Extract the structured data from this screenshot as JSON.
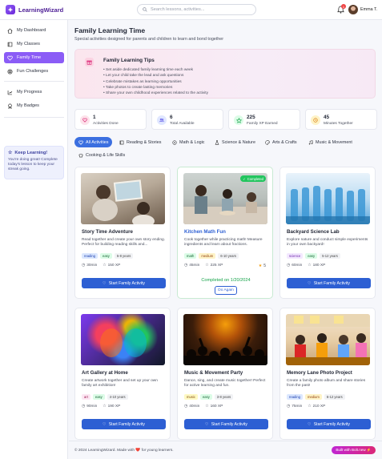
{
  "app": {
    "name": "LearningWizard"
  },
  "search": {
    "placeholder": "Search lessons, activities..."
  },
  "header": {
    "notification_count": "1",
    "user_name": "Emma T."
  },
  "sidebar": {
    "items": [
      {
        "label": "My Dashboard",
        "icon": "home-icon"
      },
      {
        "label": "My Classes",
        "icon": "book-icon"
      },
      {
        "label": "Family Time",
        "icon": "heart-icon",
        "active": true
      },
      {
        "label": "Fun Challenges",
        "icon": "target-icon"
      },
      {
        "label": "My Progress",
        "icon": "chart-icon"
      },
      {
        "label": "My Badges",
        "icon": "award-icon"
      }
    ],
    "motivation": {
      "title": "Keep Learning!",
      "text": "You're doing great! Complete today's lesson to keep your streak going."
    }
  },
  "page": {
    "title": "Family Learning Time",
    "subtitle": "Special activities designed for parents and children to learn and bond together"
  },
  "tips": {
    "title": "Family Learning Tips",
    "items": [
      "• Set aside dedicated family learning time each week",
      "• Let your child take the lead and ask questions",
      "• Celebrate mistakes as learning opportunities",
      "• Take photos to create lasting memories",
      "• Share your own childhood experiences related to the activity"
    ]
  },
  "stats": [
    {
      "value": "1",
      "label": "Activities Done",
      "color": "#fde2ea"
    },
    {
      "value": "6",
      "label": "Total Available",
      "color": "#e0e7ff"
    },
    {
      "value": "225",
      "label": "Family XP Earned",
      "color": "#dcfce7"
    },
    {
      "value": "45",
      "label": "Minutes Together",
      "color": "#fef3c7"
    }
  ],
  "filters": [
    {
      "label": "All Activities",
      "icon": "heart-icon",
      "active": true
    },
    {
      "label": "Reading & Stories",
      "icon": "book-icon"
    },
    {
      "label": "Math & Logic",
      "icon": "calculator-icon"
    },
    {
      "label": "Science & Nature",
      "icon": "flask-icon"
    },
    {
      "label": "Arts & Crafts",
      "icon": "palette-icon"
    },
    {
      "label": "Music & Movement",
      "icon": "music-icon"
    },
    {
      "label": "Cooking & Life Skills",
      "icon": "chef-hat-icon"
    }
  ],
  "activities": [
    {
      "title": "Story Time Adventure",
      "desc": "Read together and create your own story ending. Perfect for building reading skills and...",
      "tags": [
        "reading",
        "easy",
        "5-8 years"
      ],
      "time": "30min",
      "xp": "150 XP",
      "button": "Start Family Activity"
    },
    {
      "title": "Kitchen Math Fun",
      "desc": "Cook together while practicing math! Measure ingredients and learn about fractions.",
      "tags": [
        "math",
        "medium",
        "6-10 years"
      ],
      "time": "45min",
      "xp": "225 XP",
      "rating": "5",
      "badge": "Completed",
      "completed_on": "Completed on 1/20/2024",
      "button": "Do Again"
    },
    {
      "title": "Backyard Science Lab",
      "desc": "Explore nature and conduct simple experiments in your own backyard!",
      "tags": [
        "science",
        "easy",
        "5-12 years"
      ],
      "time": "60min",
      "xp": "180 XP",
      "button": "Start Family Activity"
    },
    {
      "title": "Art Gallery at Home",
      "desc": "Create artwork together and set up your own family art exhibition!",
      "tags": [
        "art",
        "easy",
        "4-10 years"
      ],
      "time": "90min",
      "xp": "190 XP",
      "button": "Start Family Activity"
    },
    {
      "title": "Music & Movement Party",
      "desc": "Dance, sing, and create music together! Perfect for active learning and fun.",
      "tags": [
        "music",
        "easy",
        "3-8 years"
      ],
      "time": "40min",
      "xp": "160 XP",
      "button": "Start Family Activity"
    },
    {
      "title": "Memory Lane Photo Project",
      "desc": "Create a family photo album and share stories from the past!",
      "tags": [
        "reading",
        "medium",
        "6-12 years"
      ],
      "time": "75min",
      "xp": "210 XP",
      "button": "Start Family Activity"
    }
  ],
  "footer": {
    "text": "© 2024 LearningWizard. Made with ❤️ for young learners.",
    "built": "Built with Bolt.new ⚡"
  },
  "colors": {
    "accent": "#8b5cf6",
    "primary": "#2d5fd3",
    "success": "#22c55e"
  }
}
